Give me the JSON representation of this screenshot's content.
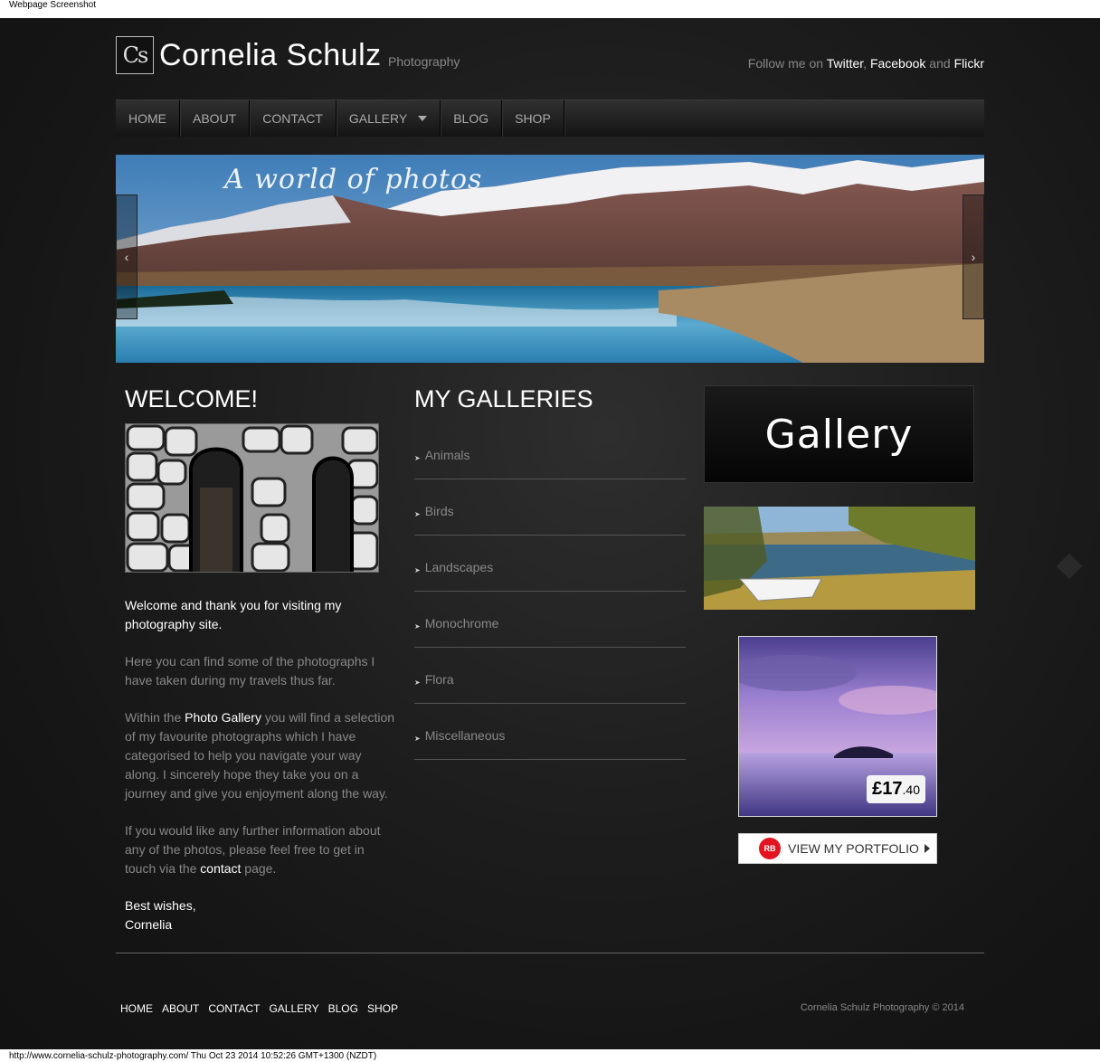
{
  "captions": {
    "top": "Webpage Screenshot",
    "bottom": "http://www.cornelia-schulz-photography.com/ Thu Oct 23 2014 10:52:26 GMT+1300 (NZDT)"
  },
  "header": {
    "logo_text": "Cs",
    "site_name": "Cornelia Schulz",
    "tagline": "Photography",
    "follow_prefix": "Follow me on ",
    "follow_twitter": "Twitter",
    "follow_sep1": ", ",
    "follow_facebook": "Facebook",
    "follow_sep2": " and ",
    "follow_flickr": "Flickr"
  },
  "nav": {
    "home": "HOME",
    "about": "ABOUT",
    "contact": "CONTACT",
    "gallery": "GALLERY",
    "blog": "BLOG",
    "shop": "SHOP"
  },
  "slider": {
    "title": "A world of photos",
    "prev_glyph": "‹",
    "next_glyph": "›"
  },
  "welcome": {
    "title": "WELCOME!",
    "p1": "Welcome and thank you for visiting my photography site.",
    "p2": "Here you can find some of the photographs I have taken during my travels thus far.",
    "p3_a": "Within the ",
    "p3_link": "Photo Gallery",
    "p3_b": " you will find a selection of my favourite photographs which I have categorised to help you navigate your way along. I sincerely hope they take you on a journey and give you enjoyment along the way.",
    "p4_a": "If you would like any further information about any of the photos, please feel free to get in touch via the ",
    "p4_link": "contact",
    "p4_b": " page.",
    "signoff1": "Best wishes,",
    "signoff2": "Cornelia"
  },
  "galleries": {
    "title": "MY GALLERIES",
    "items": [
      "Animals",
      "Birds",
      "Landscapes",
      "Monochrome",
      "Flora",
      "Miscellaneous"
    ]
  },
  "sidebar": {
    "gallery_banner": "Gallery",
    "price_main": "£17",
    "price_cents": ".40",
    "rb_logo": "RB",
    "portfolio_label": "VIEW MY PORTFOLIO"
  },
  "footer": {
    "home": "HOME",
    "about": "ABOUT",
    "contact": "CONTACT",
    "gallery": "GALLERY",
    "blog": "BLOG",
    "shop": "SHOP",
    "copyright": "Cornelia Schulz Photography © 2014"
  },
  "colors": {
    "background": "#1b1b1b",
    "accent_link": "#ffffff",
    "muted_text": "#888888",
    "redbubble_red": "#e41321"
  }
}
